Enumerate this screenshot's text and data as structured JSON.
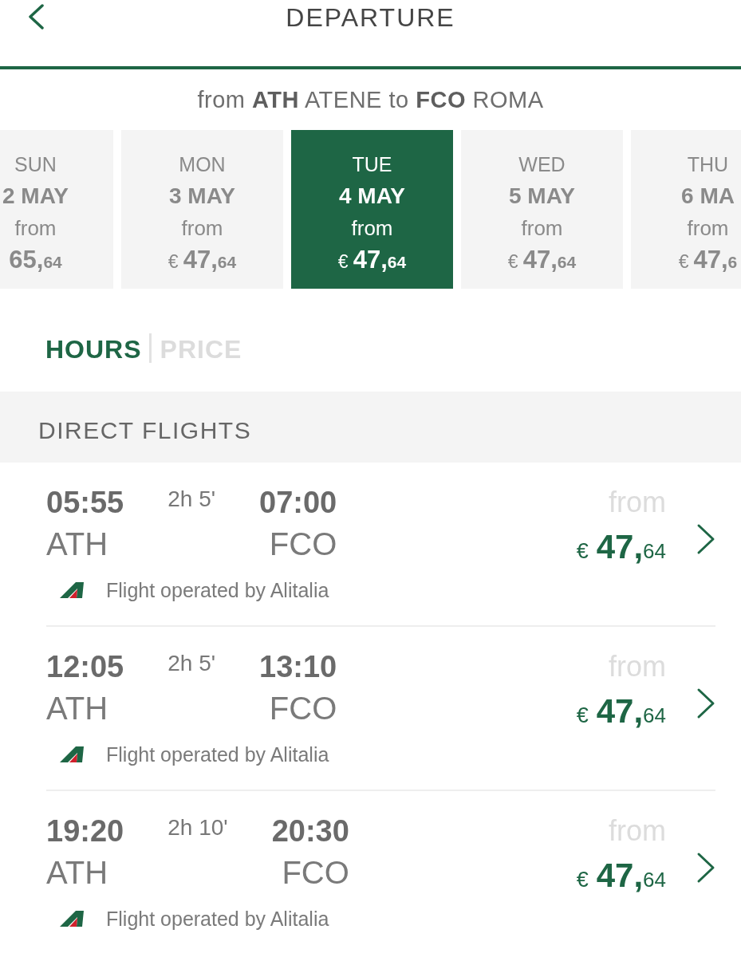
{
  "header": {
    "title": "DEPARTURE"
  },
  "route": "from **ATH** ATENE to **FCO** ROMA",
  "dates": [
    {
      "weekday": "SUN",
      "date": "2 MAY",
      "from_label": "from",
      "price": {
        "whole": "65,",
        "cents": "64"
      },
      "selected": false
    },
    {
      "weekday": "MON",
      "date": "3 MAY",
      "from_label": "from",
      "price": {
        "currency": "€",
        "whole": "47,",
        "cents": "64"
      },
      "selected": false
    },
    {
      "weekday": "TUE",
      "date": "4 MAY",
      "from_label": "from",
      "price": {
        "currency": "€",
        "whole": "47,",
        "cents": "64"
      },
      "selected": true
    },
    {
      "weekday": "WED",
      "date": "5 MAY",
      "from_label": "from",
      "price": {
        "currency": "€",
        "whole": "47,",
        "cents": "64"
      },
      "selected": false
    },
    {
      "weekday": "THU",
      "date": "6 MA",
      "from_label": "from",
      "price": {
        "currency": "€",
        "whole": "47,",
        "cents": "6"
      },
      "selected": false
    }
  ],
  "sort_tabs": [
    {
      "label": "HOURS",
      "selected": true
    },
    {
      "label": "PRICE",
      "selected": false
    }
  ],
  "section_title": "DIRECT FLIGHTS",
  "flights": [
    {
      "departure_time": "05:55",
      "duration": "2h 5'",
      "arrival_time": "07:00",
      "origin": "ATH",
      "destination": "FCO",
      "operator": "Flight operated by Alitalia",
      "from_label": "from",
      "price": {
        "currency": "€",
        "whole": "47,",
        "cents": "64"
      }
    },
    {
      "departure_time": "12:05",
      "duration": "2h 5'",
      "arrival_time": "13:10",
      "origin": "ATH",
      "destination": "FCO",
      "operator": "Flight operated by Alitalia",
      "from_label": "from",
      "price": {
        "currency": "€",
        "whole": "47,",
        "cents": "64"
      }
    },
    {
      "departure_time": "19:20",
      "duration": "2h 10'",
      "arrival_time": "20:30",
      "origin": "ATH",
      "destination": "FCO",
      "operator": "Flight operated by Alitalia",
      "from_label": "from",
      "price": {
        "currency": "€",
        "whole": "47,",
        "cents": "64"
      }
    }
  ]
}
